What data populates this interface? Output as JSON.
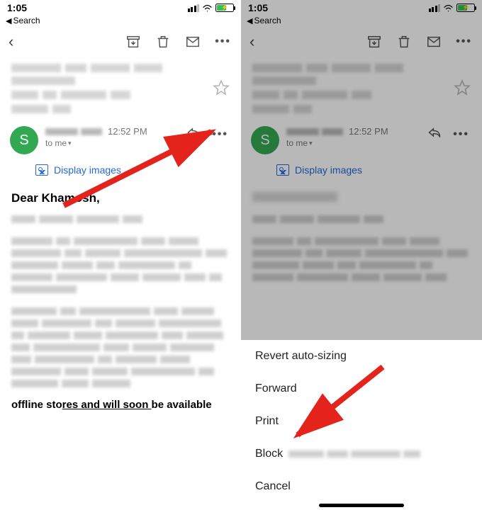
{
  "status": {
    "time": "1:05",
    "back_label": "Search"
  },
  "toolbar": {},
  "sender": {
    "avatar_initial": "S",
    "time": "12:52 PM",
    "to_line": "to me",
    "display_images": "Display images"
  },
  "body": {
    "greeting": "Dear Khamosh,",
    "footer_text": "offline stores and will soon be available"
  },
  "sheet": {
    "revert": "Revert auto-sizing",
    "forward": "Forward",
    "print": "Print",
    "block": "Block",
    "cancel": "Cancel"
  },
  "colors": {
    "accent_green": "#33a852",
    "link_blue": "#2469d6",
    "arrow_red": "#e4231c"
  }
}
